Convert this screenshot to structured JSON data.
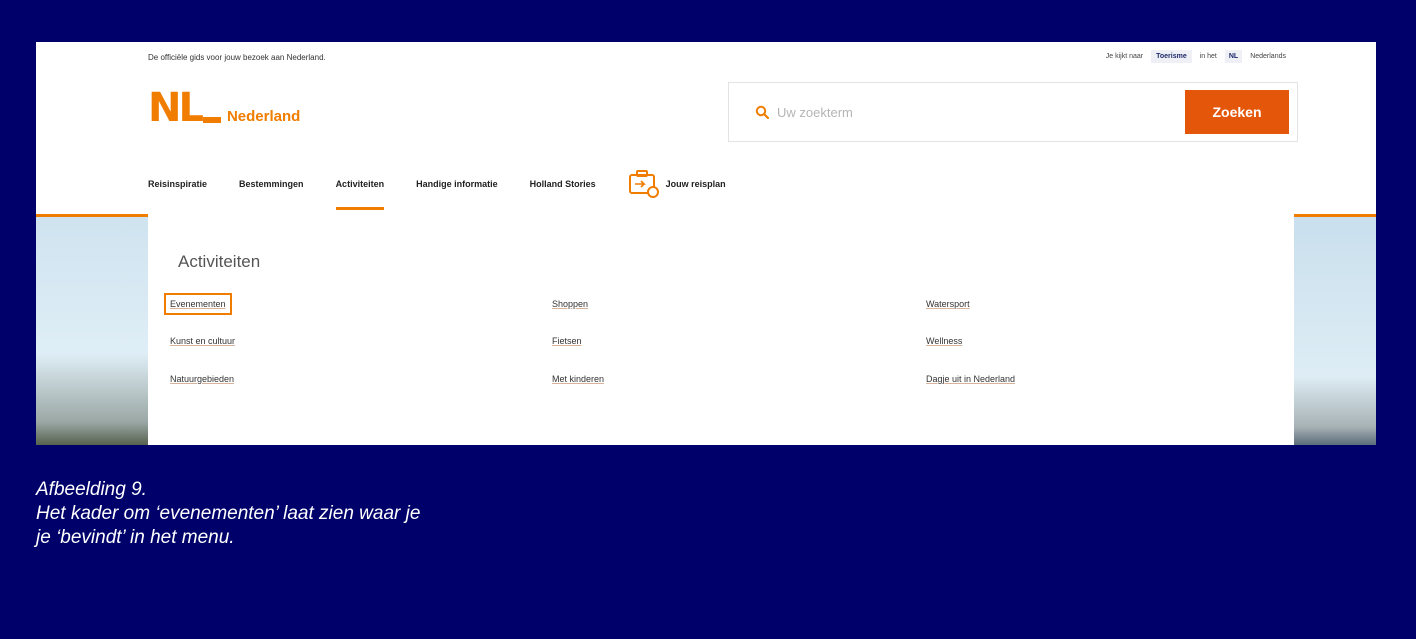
{
  "topbar": {
    "tagline": "De officiële gids voor jouw bezoek aan Nederland.",
    "viewing_label": "Je kijkt naar",
    "mode": "Toerisme",
    "in_label": "in het",
    "lang_code": "NL",
    "lang_name": "Nederlands"
  },
  "logo": {
    "mark": "NL",
    "text": "Nederland"
  },
  "search": {
    "placeholder": "Uw zoekterm",
    "button": "Zoeken"
  },
  "nav": {
    "items": [
      "Reisinspiratie",
      "Bestemmingen",
      "Activiteiten",
      "Handige informatie",
      "Holland Stories"
    ],
    "plan": "Jouw reisplan"
  },
  "menu": {
    "title": "Activiteiten",
    "col1": [
      "Evenementen",
      "Kunst en cultuur",
      "Natuurgebieden"
    ],
    "col2": [
      "Shoppen",
      "Fietsen",
      "Met kinderen"
    ],
    "col3": [
      "Watersport",
      "Wellness",
      "Dagje uit in Nederland"
    ]
  },
  "caption": {
    "line1": "Afbeelding 9.",
    "line2": "Het kader om ‘evenementen’ laat zien waar je",
    "line3": "je ‘bevindt’ in het menu."
  },
  "colors": {
    "brand": "#f07d00",
    "button": "#e4570b",
    "background": "#00006b"
  }
}
